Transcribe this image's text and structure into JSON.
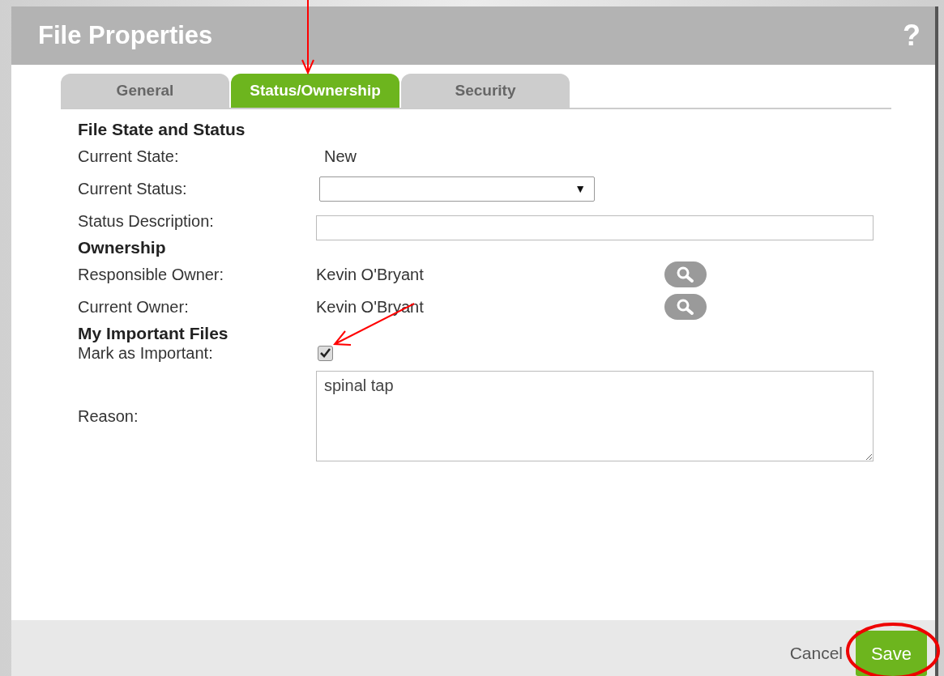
{
  "dialog": {
    "title": "File Properties",
    "help": "?"
  },
  "tabs": [
    {
      "label": "General",
      "selected": false
    },
    {
      "label": "Status/Ownership",
      "selected": true
    },
    {
      "label": "Security",
      "selected": false
    }
  ],
  "sections": [
    {
      "heading": "File State and Status",
      "fields": [
        {
          "kind": "text",
          "label": "Current State:",
          "value": "New"
        },
        {
          "kind": "select",
          "label": "Current Status:",
          "arrow": "▼"
        },
        {
          "kind": "input",
          "label": "Status Description:"
        }
      ]
    },
    {
      "heading": "Ownership",
      "fields": [
        {
          "kind": "owner",
          "label": "Responsible Owner:",
          "value": "Kevin O'Bryant"
        },
        {
          "kind": "owner",
          "label": "Current Owner:",
          "value": "Kevin O'Bryant"
        }
      ]
    },
    {
      "heading": "My Important Files",
      "fields": [
        {
          "kind": "checkbox",
          "label": "Mark as Important:",
          "checked": true
        },
        {
          "kind": "textarea",
          "label": "Reason:",
          "value": "spinal tap"
        }
      ]
    }
  ],
  "footer": {
    "cancel": "Cancel",
    "save": "Save"
  }
}
